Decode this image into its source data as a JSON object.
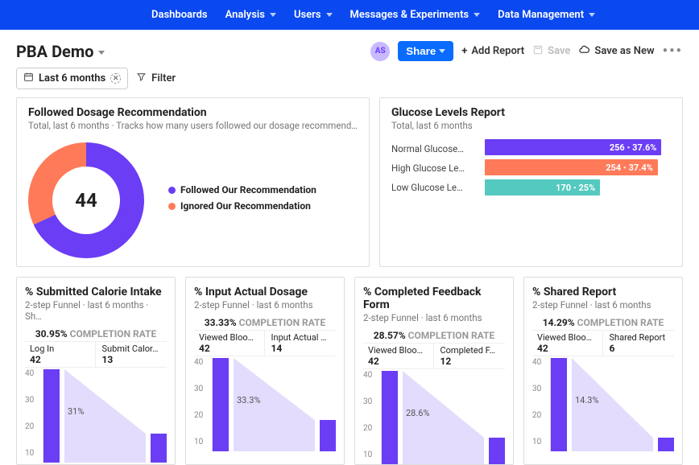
{
  "nav": {
    "items": [
      "Dashboards",
      "Analysis",
      "Users",
      "Messages & Experiments",
      "Data Management"
    ],
    "hasDropdown": [
      false,
      true,
      true,
      true,
      true
    ]
  },
  "page": {
    "title": "PBA Demo",
    "avatar": "AS",
    "share": "Share",
    "addReport": "Add Report",
    "save": "Save",
    "saveAsNew": "Save as New",
    "dateRange": "Last 6 months",
    "filter": "Filter"
  },
  "dosageCard": {
    "title": "Followed Dosage Recommendation",
    "subtitle": "Total, last 6 months · Tracks how many users followed our dosage recommend…",
    "centerValue": "44",
    "legend": [
      "Followed Our Recommendation",
      "Ignored Our Recommendation"
    ],
    "colors": [
      "#6b3df5",
      "#ff7a59"
    ]
  },
  "glucoseCard": {
    "title": "Glucose Levels Report",
    "subtitle": "Total, last 6 months",
    "rows": [
      {
        "label": "Normal Glucose…",
        "value": "256",
        "pct": "37.6%",
        "color": "#6b3df5",
        "widthPct": 95
      },
      {
        "label": "High Glucose Le…",
        "value": "254",
        "pct": "37.4%",
        "color": "#ff7a59",
        "widthPct": 93
      },
      {
        "label": "Low Glucose Le…",
        "value": "170",
        "pct": "25%",
        "color": "#54c9bf",
        "widthPct": 62
      }
    ]
  },
  "funnels": [
    {
      "title": "% Submitted Calorie Intake",
      "subtitle": "2-step Funnel · last 6 months · Sh…",
      "completion": "30.95%",
      "steps": [
        {
          "name": "Log In",
          "count": "42"
        },
        {
          "name": "Submit Calor…",
          "count": "13"
        }
      ],
      "dropLabel": "31%",
      "bar1": 42,
      "bar2": 13,
      "ymax": 42,
      "yticks": [
        "40",
        "30",
        "20",
        "10"
      ]
    },
    {
      "title": "% Input Actual Dosage",
      "subtitle": "2-step Funnel · last 6 months",
      "completion": "33.33%",
      "steps": [
        {
          "name": "Viewed Bloo…",
          "count": "42"
        },
        {
          "name": "Input Actual …",
          "count": "14"
        }
      ],
      "dropLabel": "33.3%",
      "bar1": 42,
      "bar2": 14,
      "ymax": 42,
      "yticks": [
        "40",
        "30",
        "20",
        "10"
      ]
    },
    {
      "title": "% Completed Feedback Form",
      "subtitle": "2-step Funnel · last 6 months",
      "completion": "28.57%",
      "steps": [
        {
          "name": "Viewed Bloo…",
          "count": "42"
        },
        {
          "name": "Completed F…",
          "count": "12"
        }
      ],
      "dropLabel": "28.6%",
      "bar1": 42,
      "bar2": 12,
      "ymax": 42,
      "yticks": [
        "40",
        "30",
        "20",
        "10"
      ]
    },
    {
      "title": "% Shared Report",
      "subtitle": "2-step Funnel · last 6 months",
      "completion": "14.29%",
      "steps": [
        {
          "name": "Viewed Bloo…",
          "count": "42"
        },
        {
          "name": "Shared Report",
          "count": "6"
        }
      ],
      "dropLabel": "14.3%",
      "bar1": 42,
      "bar2": 6,
      "ymax": 42,
      "yticks": [
        "40",
        "30",
        "20",
        "10"
      ]
    }
  ],
  "chart_data": [
    {
      "type": "pie",
      "title": "Followed Dosage Recommendation",
      "categories": [
        "Followed Our Recommendation",
        "Ignored Our Recommendation"
      ],
      "values": [
        68,
        32
      ],
      "total": 44
    },
    {
      "type": "bar",
      "title": "Glucose Levels Report",
      "categories": [
        "Normal Glucose",
        "High Glucose Level",
        "Low Glucose Level"
      ],
      "values": [
        256,
        254,
        170
      ],
      "percentages": [
        37.6,
        37.4,
        25
      ]
    },
    {
      "type": "bar",
      "title": "% Submitted Calorie Intake",
      "categories": [
        "Log In",
        "Submit Calorie"
      ],
      "values": [
        42,
        13
      ],
      "completion_rate": 30.95,
      "ylim": [
        0,
        42
      ]
    },
    {
      "type": "bar",
      "title": "% Input Actual Dosage",
      "categories": [
        "Viewed Blood",
        "Input Actual"
      ],
      "values": [
        42,
        14
      ],
      "completion_rate": 33.33,
      "ylim": [
        0,
        42
      ]
    },
    {
      "type": "bar",
      "title": "% Completed Feedback Form",
      "categories": [
        "Viewed Blood",
        "Completed Form"
      ],
      "values": [
        42,
        12
      ],
      "completion_rate": 28.57,
      "ylim": [
        0,
        42
      ]
    },
    {
      "type": "bar",
      "title": "% Shared Report",
      "categories": [
        "Viewed Blood",
        "Shared Report"
      ],
      "values": [
        42,
        6
      ],
      "completion_rate": 14.29,
      "ylim": [
        0,
        42
      ]
    }
  ]
}
